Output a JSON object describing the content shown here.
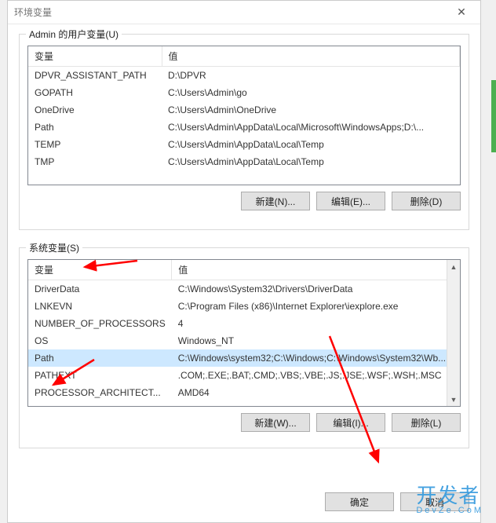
{
  "window": {
    "title": "环境变量",
    "close_glyph": "✕"
  },
  "user_vars": {
    "group_label": "Admin 的用户变量(U)",
    "col_var": "变量",
    "col_val": "值",
    "rows": [
      {
        "name": "DPVR_ASSISTANT_PATH",
        "value": "D:\\DPVR"
      },
      {
        "name": "GOPATH",
        "value": "C:\\Users\\Admin\\go"
      },
      {
        "name": "OneDrive",
        "value": "C:\\Users\\Admin\\OneDrive"
      },
      {
        "name": "Path",
        "value": "C:\\Users\\Admin\\AppData\\Local\\Microsoft\\WindowsApps;D:\\..."
      },
      {
        "name": "TEMP",
        "value": "C:\\Users\\Admin\\AppData\\Local\\Temp"
      },
      {
        "name": "TMP",
        "value": "C:\\Users\\Admin\\AppData\\Local\\Temp"
      }
    ],
    "btn_new": "新建(N)...",
    "btn_edit": "编辑(E)...",
    "btn_delete": "删除(D)"
  },
  "system_vars": {
    "group_label": "系统变量(S)",
    "col_var": "变量",
    "col_val": "值",
    "rows": [
      {
        "name": "DriverData",
        "value": "C:\\Windows\\System32\\Drivers\\DriverData"
      },
      {
        "name": "LNKEVN",
        "value": "C:\\Program Files (x86)\\Internet Explorer\\iexplore.exe"
      },
      {
        "name": "NUMBER_OF_PROCESSORS",
        "value": "4"
      },
      {
        "name": "OS",
        "value": "Windows_NT"
      },
      {
        "name": "Path",
        "value": "C:\\Windows\\system32;C:\\Windows;C:\\Windows\\System32\\Wb...",
        "selected": true
      },
      {
        "name": "PATHEXT",
        "value": ".COM;.EXE;.BAT;.CMD;.VBS;.VBE;.JS;.JSE;.WSF;.WSH;.MSC"
      },
      {
        "name": "PROCESSOR_ARCHITECT...",
        "value": "AMD64"
      }
    ],
    "btn_new": "新建(W)...",
    "btn_edit": "编辑(I)...",
    "btn_delete": "删除(L)"
  },
  "dialog": {
    "ok": "确定",
    "cancel": "取消"
  },
  "watermark": {
    "main": "开发者",
    "sub": "DevZe.CoM"
  }
}
